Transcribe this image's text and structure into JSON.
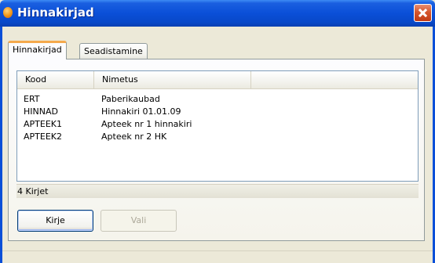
{
  "window": {
    "title": "Hinnakirjad",
    "accent_color": "#0a4fd8",
    "close_color": "#d6562d"
  },
  "tabs": [
    {
      "label": "Hinnakirjad",
      "active": true
    },
    {
      "label": "Seadistamine",
      "active": false
    }
  ],
  "list": {
    "columns": [
      "Kood",
      "Nimetus"
    ],
    "rows": [
      {
        "kood": "ERT",
        "nimetus": "Paberikaubad"
      },
      {
        "kood": "HINNAD",
        "nimetus": "Hinnakiri 01.01.09"
      },
      {
        "kood": "APTEEK1",
        "nimetus": "Apteek nr 1 hinnakiri"
      },
      {
        "kood": "APTEEK2",
        "nimetus": "Apteek nr 2 HK"
      }
    ]
  },
  "status": {
    "text": "4 Kirjet"
  },
  "buttons": {
    "kirje_label": "Kirje",
    "vali_label": "Vali",
    "vali_enabled": false
  },
  "icons": {
    "title_icon": "app-icon",
    "close_icon": "close-icon"
  }
}
